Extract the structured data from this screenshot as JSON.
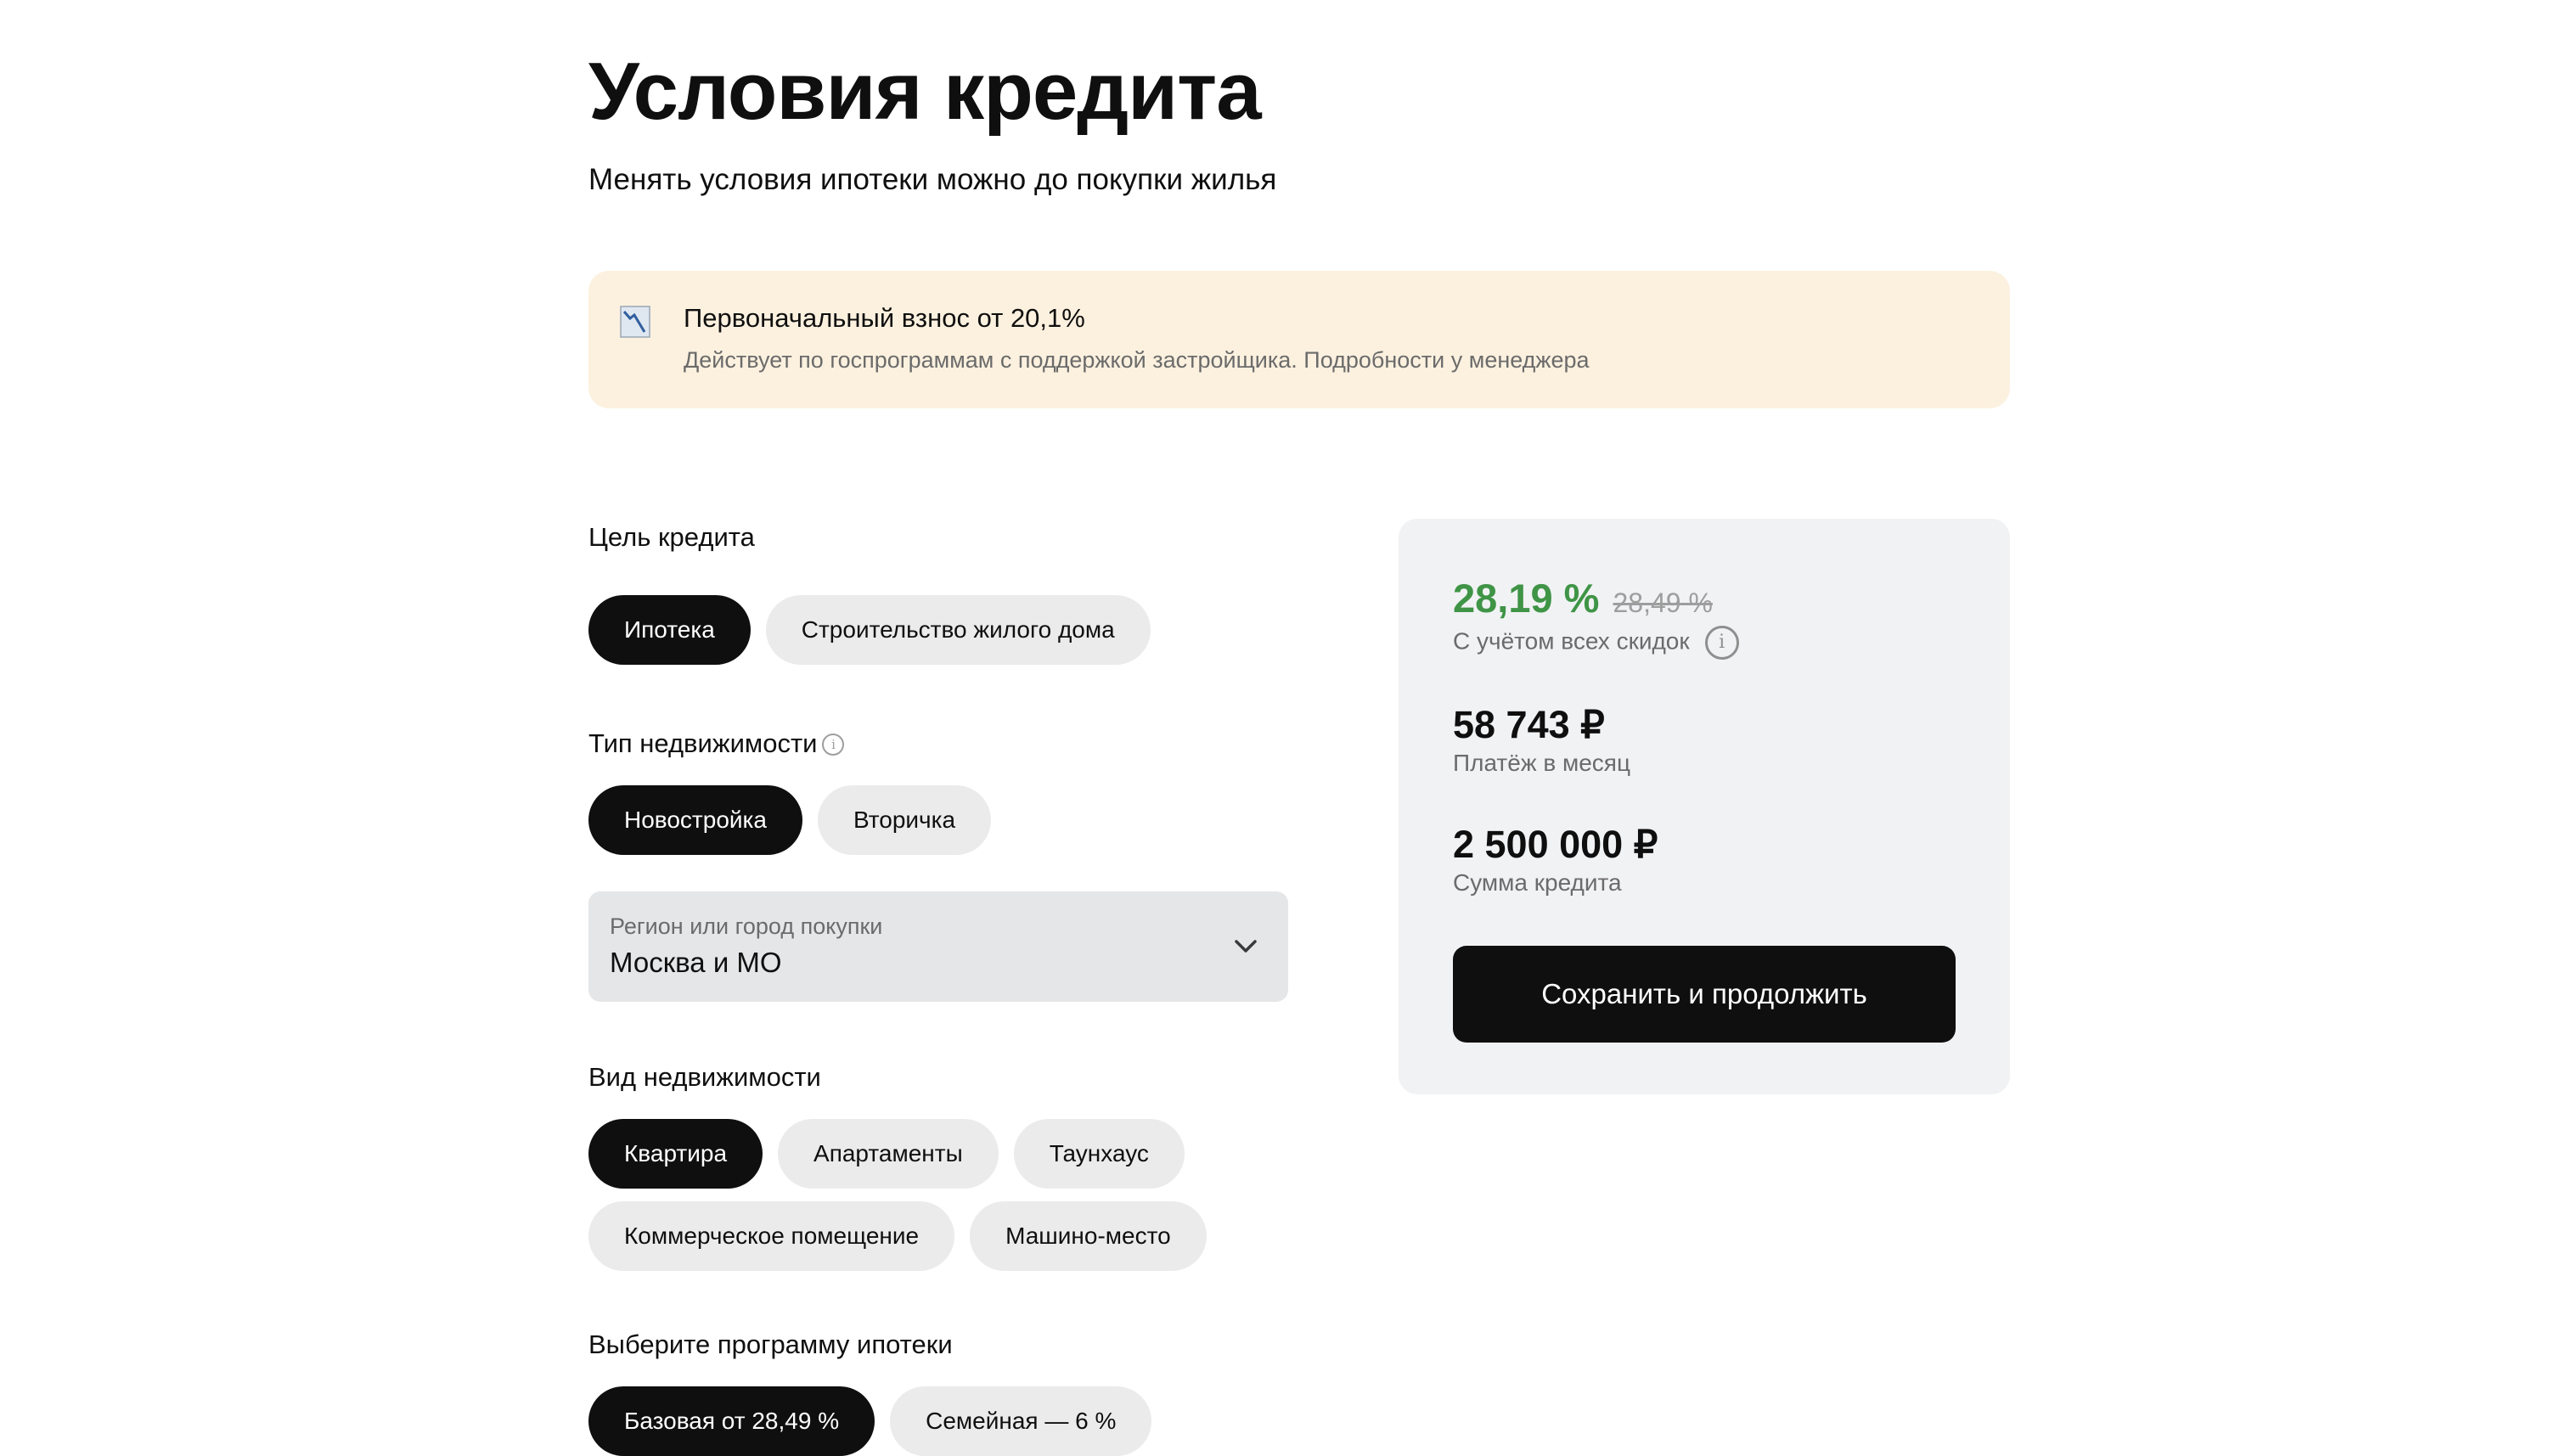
{
  "page": {
    "title": "Условия кредита",
    "subtitle": "Менять условия ипотеки можно до покупки жилья"
  },
  "notice": {
    "icon": "chart-down-icon",
    "title": "Первоначальный взнос от 20,1%",
    "text": "Действует по госпрограммам с поддержкой застройщика. Подробности у менеджера",
    "background": "#fcf1df"
  },
  "purpose": {
    "label": "Цель кредита",
    "options": [
      "Ипотека",
      "Строительство жилого дома"
    ],
    "selected": "Ипотека"
  },
  "property_type": {
    "label": "Тип недвижимости",
    "options": [
      "Новостройка",
      "Вторичка"
    ],
    "selected": "Новостройка"
  },
  "region": {
    "label": "Регион или город покупки",
    "value": "Москва и МО"
  },
  "property_kind": {
    "label": "Вид недвижимости",
    "options": [
      "Квартира",
      "Апартаменты",
      "Таунхаус",
      "Коммерческое помещение",
      "Машино-место"
    ],
    "selected": "Квартира"
  },
  "program": {
    "label": "Выберите программу ипотеки",
    "options": [
      "Базовая от 28,49 %",
      "Семейная — 6 %"
    ],
    "selected": "Базовая от 28,49 %"
  },
  "summary": {
    "rate": "28,19 %",
    "old_rate": "28,49 %",
    "rate_caption": "С учётом всех скидок",
    "monthly_payment": "58 743 ₽",
    "monthly_payment_caption": "Платёж в месяц",
    "loan_amount": "2 500 000 ₽",
    "loan_amount_caption": "Сумма кредита",
    "button_label": "Сохранить и продолжить",
    "accent_color": "#3f9446"
  },
  "colors": {
    "chip_active": "#0f0f0f",
    "chip_inactive": "#ebebeb",
    "panel": "#f1f2f4"
  }
}
